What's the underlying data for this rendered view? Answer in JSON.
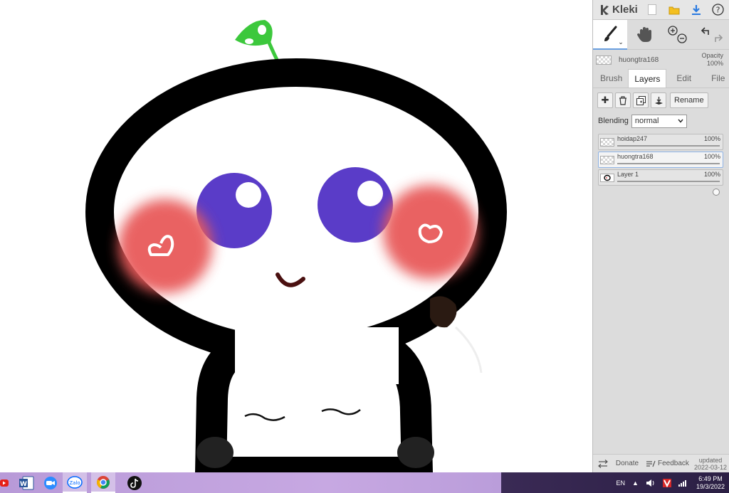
{
  "app": {
    "name": "Kleki"
  },
  "header": {
    "icons": [
      "new-image-icon",
      "open-folder-icon",
      "download-icon",
      "help-icon"
    ]
  },
  "tools": {
    "items": [
      "brush-tool",
      "hand-tool",
      "zoom-tool",
      "undo-redo"
    ]
  },
  "current_layer": {
    "name": "huongtra168",
    "opacity_label": "Opacity",
    "opacity_value": "100%"
  },
  "tabs": [
    {
      "label": "Brush"
    },
    {
      "label": "Layers"
    },
    {
      "label": "Edit"
    },
    {
      "label": "File"
    }
  ],
  "active_tab": "Layers",
  "layer_actions": {
    "rename_label": "Rename"
  },
  "blending": {
    "label": "Blending",
    "value": "normal"
  },
  "layers": [
    {
      "name": "hoidap247",
      "opacity": "100%",
      "opacity_fraction": 1.0
    },
    {
      "name": "huongtra168",
      "opacity": "100%",
      "opacity_fraction": 1.0,
      "active": true
    },
    {
      "name": "Layer 1",
      "opacity": "100%",
      "opacity_fraction": 1.0
    }
  ],
  "footer": {
    "donate": "Donate",
    "feedback": "Feedback",
    "updated_label": "updated",
    "updated_date": "2022-03-12"
  },
  "taskbar": {
    "apps": [
      "youtube-icon",
      "word-icon",
      "zoom-icon",
      "zalo-icon",
      "chrome-icon",
      "tiktok-icon"
    ],
    "language": "EN",
    "time": "6:49 PM",
    "date": "19/3/2022"
  },
  "colors": {
    "panel": "#dcdcdc",
    "accent": "#6a9fe0",
    "eye": "#5a3cc8",
    "cheek": "#e85a5a",
    "sprout": "#3cc83c"
  }
}
